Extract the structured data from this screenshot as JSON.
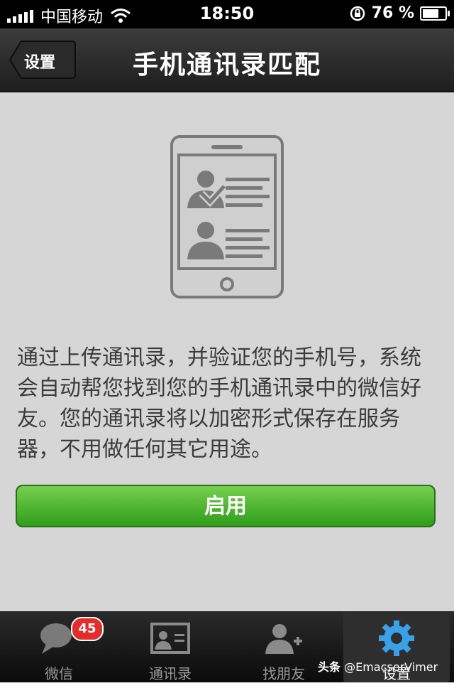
{
  "status_bar": {
    "carrier": "中国移动",
    "time": "18:50",
    "battery_percent": "76 %",
    "battery_level": 0.76
  },
  "nav": {
    "back_label": "设置",
    "title": "手机通讯录匹配"
  },
  "content": {
    "description": "通过上传通讯录，并验证您的手机号，系统会自动帮您找到您的手机通讯录中的微信好友。您的通讯录将以加密形式保存在服务器，不用做任何其它用途。",
    "enable_label": "启用"
  },
  "tab_bar": {
    "tabs": [
      {
        "label": "微信",
        "badge": "45",
        "icon": "chat-bubble-icon"
      },
      {
        "label": "通讯录",
        "icon": "contacts-card-icon"
      },
      {
        "label": "找朋友",
        "icon": "add-friend-icon"
      },
      {
        "label": "设置",
        "icon": "gear-icon",
        "selected": true
      }
    ]
  },
  "watermark": {
    "brand": "头条",
    "handle": "@EmacserVimer"
  }
}
